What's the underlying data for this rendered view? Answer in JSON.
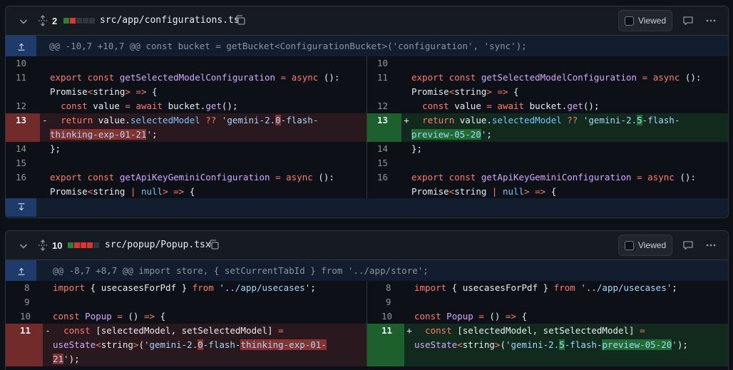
{
  "colors": {
    "added": "#347d39",
    "removed": "#da3633",
    "neutral": "#30363d",
    "hunk_bg": "#121d2f",
    "expander_bg": "#1f3b6b"
  },
  "files": [
    {
      "change_count": "2",
      "bars": [
        "added",
        "removed",
        "neutral",
        "neutral",
        "neutral"
      ],
      "path": "src/app/configurations.ts",
      "viewed_label": "Viewed",
      "hunk_header": "@@ -10,7 +10,7 @@ const bucket = getBucket<ConfigurationBucket>('configuration', 'sync');",
      "left_lines": [
        {
          "n": "10",
          "type": "ctx"
        },
        {
          "n": "11",
          "type": "ctx",
          "code": "export const getSelectedModelConfiguration = async ():\nPromise<string> => {"
        },
        {
          "n": "12",
          "type": "ctx",
          "code": "  const value = await bucket.get();"
        },
        {
          "n": "13",
          "type": "del",
          "marker": "-",
          "code": "  return value.selectedModel ?? 'gemini-2.0-flash-\nthinking-exp-01-21';"
        },
        {
          "n": "14",
          "type": "ctx",
          "code": "};"
        },
        {
          "n": "15",
          "type": "ctx"
        },
        {
          "n": "16",
          "type": "ctx",
          "code": "export const getApiKeyGeminiConfiguration = async ():\nPromise<string | null> => {"
        }
      ],
      "right_lines": [
        {
          "n": "10",
          "type": "ctx"
        },
        {
          "n": "11",
          "type": "ctx",
          "code": "export const getSelectedModelConfiguration = async ():\nPromise<string> => {"
        },
        {
          "n": "12",
          "type": "ctx",
          "code": "  const value = await bucket.get();"
        },
        {
          "n": "13",
          "type": "add",
          "marker": "+",
          "code": "  return value.selectedModel ?? 'gemini-2.5-flash-\npreview-05-20';"
        },
        {
          "n": "14",
          "type": "ctx",
          "code": "};"
        },
        {
          "n": "15",
          "type": "ctx"
        },
        {
          "n": "16",
          "type": "ctx",
          "code": "export const getApiKeyGeminiConfiguration = async ():\nPromise<string | null> => {"
        }
      ]
    },
    {
      "change_count": "10",
      "bars": [
        "added",
        "removed",
        "removed",
        "removed",
        "neutral"
      ],
      "path": "src/popup/Popup.tsx",
      "viewed_label": "Viewed",
      "hunk_header": "@@ -8,7 +8,7 @@ import store, { setCurrentTabId } from '../app/store';",
      "left_lines": [
        {
          "n": "8",
          "type": "ctx",
          "code": "import { usecasesForPdf } from '../app/usecases';"
        },
        {
          "n": "9",
          "type": "ctx"
        },
        {
          "n": "10",
          "type": "ctx",
          "code": "const Popup = () => {"
        },
        {
          "n": "11",
          "type": "del",
          "marker": "-",
          "code": "  const [selectedModel, setSelectedModel] =\nuseState<string>('gemini-2.0-flash-thinking-exp-01-\n21');"
        }
      ],
      "right_lines": [
        {
          "n": "8",
          "type": "ctx",
          "code": "import { usecasesForPdf } from '../app/usecases';"
        },
        {
          "n": "9",
          "type": "ctx"
        },
        {
          "n": "10",
          "type": "ctx",
          "code": "const Popup = () => {"
        },
        {
          "n": "11",
          "type": "add",
          "marker": "+",
          "code": "  const [selectedModel, setSelectedModel] =\nuseState<string>('gemini-2.5-flash-preview-05-20');"
        }
      ]
    }
  ]
}
